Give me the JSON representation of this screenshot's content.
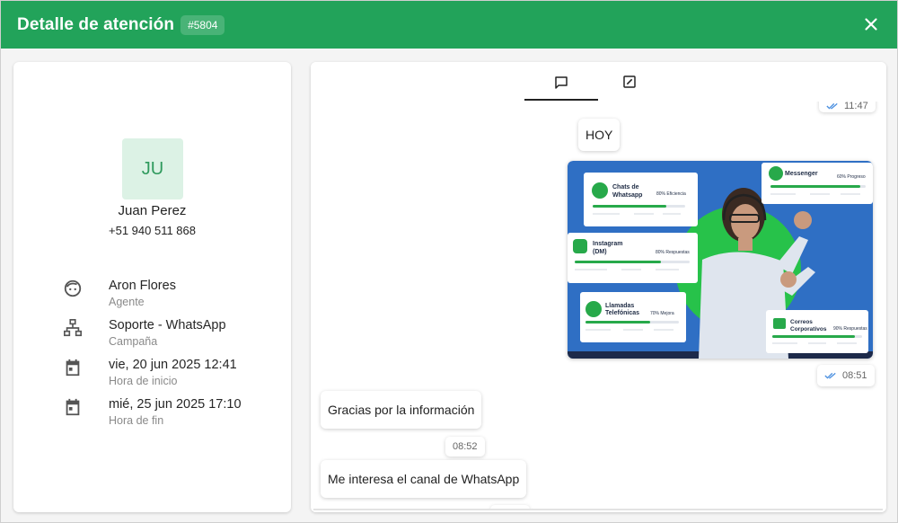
{
  "header": {
    "title": "Detalle de atención",
    "ticket_id": "#5804",
    "close_icon": "close-icon",
    "bg_color": "#22a35a"
  },
  "contact": {
    "initials": "JU",
    "name": "Juan Perez",
    "phone": "+51 940 511 868"
  },
  "details": [
    {
      "icon": "agent-icon",
      "value": "Aron Flores",
      "label": "Agente"
    },
    {
      "icon": "campaign-icon",
      "value": "Soporte - WhatsApp",
      "label": "Campaña"
    },
    {
      "icon": "calendar-icon",
      "value": "vie, 20 jun 2025 12:41",
      "label": "Hora de inicio"
    },
    {
      "icon": "calendar-icon",
      "value": "mié, 25 jun 2025 17:10",
      "label": "Hora de fin"
    }
  ],
  "tabs": [
    {
      "icon": "chat-icon",
      "active": true
    },
    {
      "icon": "note-edit-icon",
      "active": false
    }
  ],
  "messages": {
    "prev_time": "11:47",
    "day_divider": "HOY",
    "image_msg": {
      "time": "08:51",
      "cards": {
        "whatsapp": {
          "title": "Chats de Whatsapp",
          "stat": "80% Eficiencia"
        },
        "messenger": {
          "title": "Messenger",
          "stat": "60% Progreso"
        },
        "instagram": {
          "title": "Instagram (DM)",
          "stat": "80% Respuestas"
        },
        "calls": {
          "title": "Llamadas Telefónicas",
          "stat": "70% Mejora"
        },
        "email": {
          "title": "Correos Corporativos",
          "stat": "90% Respuestas"
        }
      }
    },
    "msg1": {
      "text": "Gracias por la información",
      "time": "08:52"
    },
    "msg2": {
      "text": "Me interesa el canal de WhatsApp"
    }
  },
  "colors": {
    "accent": "#22a35a",
    "avatar_bg": "#dcf2e5",
    "read_ticks": "#4a8fe0"
  }
}
